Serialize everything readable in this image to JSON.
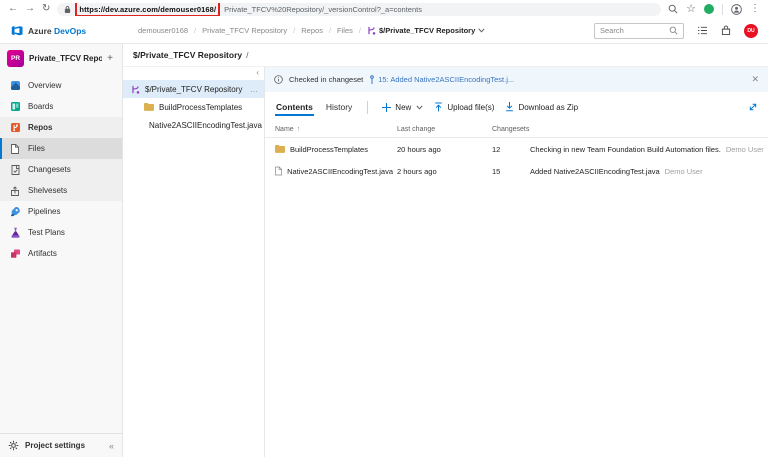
{
  "browser": {
    "url_highlighted": "https://dev.azure.com/demouser0168/",
    "url_rest": "Private_TFCV%20Repository/_versionControl?_a=contents"
  },
  "topbar": {
    "brand_azure": "Azure",
    "brand_devops": "DevOps",
    "breadcrumb": [
      "demouser0168",
      "Private_TFCV Repository",
      "Repos",
      "Files"
    ],
    "breadcrumb_separator": "/",
    "breadcrumb_current": "$/Private_TFCV Repository",
    "search_placeholder": "Search",
    "avatar_initials": "DU"
  },
  "sidebar": {
    "project_initials": "PR",
    "project_name": "Private_TFCV Reposit...",
    "items": [
      {
        "label": "Overview"
      },
      {
        "label": "Boards"
      },
      {
        "label": "Repos"
      },
      {
        "label": "Files"
      },
      {
        "label": "Changesets"
      },
      {
        "label": "Shelvesets"
      },
      {
        "label": "Pipelines"
      },
      {
        "label": "Test Plans"
      },
      {
        "label": "Artifacts"
      }
    ],
    "footer_label": "Project settings"
  },
  "content": {
    "path": "$/Private_TFCV Repository",
    "path_separator": "/",
    "tree": {
      "root": "$/Private_TFCV Repository",
      "children": [
        "BuildProcessTemplates",
        "Native2ASCIIEncodingTest.java"
      ]
    },
    "banner": {
      "message": "Checked in changeset",
      "link": "15: Added Native2ASCIIEncodingTest.j..."
    },
    "tabs": [
      {
        "label": "Contents"
      },
      {
        "label": "History"
      }
    ],
    "toolbar": {
      "new_label": "New",
      "upload_label": "Upload file(s)",
      "download_label": "Download as Zip"
    },
    "table": {
      "headers": {
        "name": "Name",
        "last_change": "Last change",
        "changesets": "Changesets"
      },
      "rows": [
        {
          "name": "BuildProcessTemplates",
          "last_change": "20 hours ago",
          "changeset": "12",
          "comment": "Checking in new Team Foundation Build Automation files.",
          "author": "Demo User"
        },
        {
          "name": "Native2ASCIIEncodingTest.java",
          "last_change": "2 hours ago",
          "changeset": "15",
          "comment": "Added Native2ASCIIEncodingTest.java",
          "author": "Demo User"
        }
      ]
    }
  },
  "colors": {
    "accent": "#0078d4",
    "banner_bg": "#eff6fc",
    "highlight_red": "#e0231c",
    "avatar_red": "#e81123",
    "project_pink": "#e3008c"
  }
}
